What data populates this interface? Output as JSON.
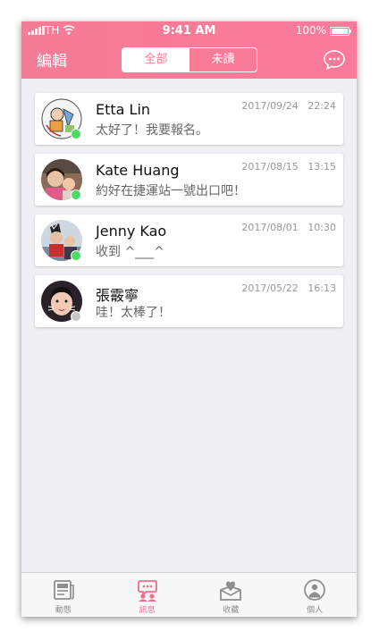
{
  "status_bar": {
    "carrier": "TH",
    "time": "9:41 AM",
    "battery": "100%"
  },
  "nav": {
    "edit_label": "編輯",
    "segments": [
      "全部",
      "未讀"
    ],
    "active_segment": 0,
    "chat_icon": "chat-bubble-icon"
  },
  "colors": {
    "header": "#f57c95",
    "accent": "#f06c8c",
    "online": "#4cd964",
    "offline": "#c8c8c8"
  },
  "conversations": [
    {
      "name": "Etta Lin",
      "date": "2017/09/24   22:24",
      "message": "太好了！我要報名。",
      "online": true
    },
    {
      "name": "Kate Huang",
      "date": "2017/08/15   13:15",
      "message": "約好在捷運站一號出口吧！",
      "online": true
    },
    {
      "name": "Jenny Kao",
      "date": "2017/08/01   10:30",
      "message": "收到 ^___^",
      "online": true
    },
    {
      "name": "張霰寧",
      "date": "2017/05/22   16:13",
      "message": "哇！太棒了！",
      "online": false
    }
  ],
  "tabs": [
    {
      "label": "動態",
      "icon": "news-icon",
      "active": false
    },
    {
      "label": "訊息",
      "icon": "message-icon",
      "active": true
    },
    {
      "label": "收藏",
      "icon": "favorite-icon",
      "active": false
    },
    {
      "label": "個人",
      "icon": "profile-icon",
      "active": false
    }
  ]
}
